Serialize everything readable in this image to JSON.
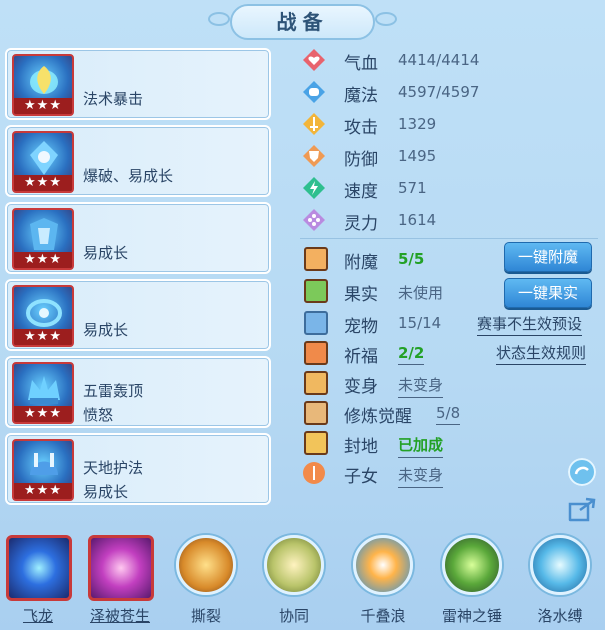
{
  "title": "战备",
  "equipment": [
    {
      "lines": [
        "法术暴击"
      ],
      "stars": "★★★"
    },
    {
      "lines": [
        "爆破、易成长"
      ],
      "stars": "★★★"
    },
    {
      "lines": [
        "易成长"
      ],
      "stars": "★★★"
    },
    {
      "lines": [
        "易成长"
      ],
      "stars": "★★★"
    },
    {
      "lines": [
        "五雷轰顶",
        "愤怒"
      ],
      "stars": "★★★"
    },
    {
      "lines": [
        "天地护法",
        "易成长"
      ],
      "stars": "★★★"
    }
  ],
  "stats": [
    {
      "label": "气血",
      "value": "4414/4414",
      "color": "#e8636d"
    },
    {
      "label": "魔法",
      "value": "4597/4597",
      "color": "#4aa3e6"
    },
    {
      "label": "攻击",
      "value": "1329",
      "color": "#f2b53a"
    },
    {
      "label": "防御",
      "value": "1495",
      "color": "#ef9a54"
    },
    {
      "label": "速度",
      "value": "571",
      "color": "#2fbf8f"
    },
    {
      "label": "灵力",
      "value": "1614",
      "color": "#b98be0"
    }
  ],
  "extras": [
    {
      "label": "附魔",
      "value": "5/5"
    },
    {
      "label": "果实",
      "value": "未使用"
    },
    {
      "label": "宠物",
      "value": "15/14"
    },
    {
      "label": "祈福",
      "value": "2/2"
    },
    {
      "label": "变身",
      "value": "未变身"
    },
    {
      "label": "修炼觉醒",
      "value": "5/8"
    },
    {
      "label": "封地",
      "value": "已加成"
    },
    {
      "label": "子女",
      "value": "未变身"
    }
  ],
  "buttons": {
    "enchant": "一键附魔",
    "fruit": "一键果实"
  },
  "links": {
    "event": "赛事不生效预设",
    "rules": "状态生效规则"
  },
  "skills": [
    "飞龙",
    "泽被苍生",
    "撕裂",
    "协同",
    "千叠浪",
    "雷神之锤",
    "洛水缚"
  ]
}
